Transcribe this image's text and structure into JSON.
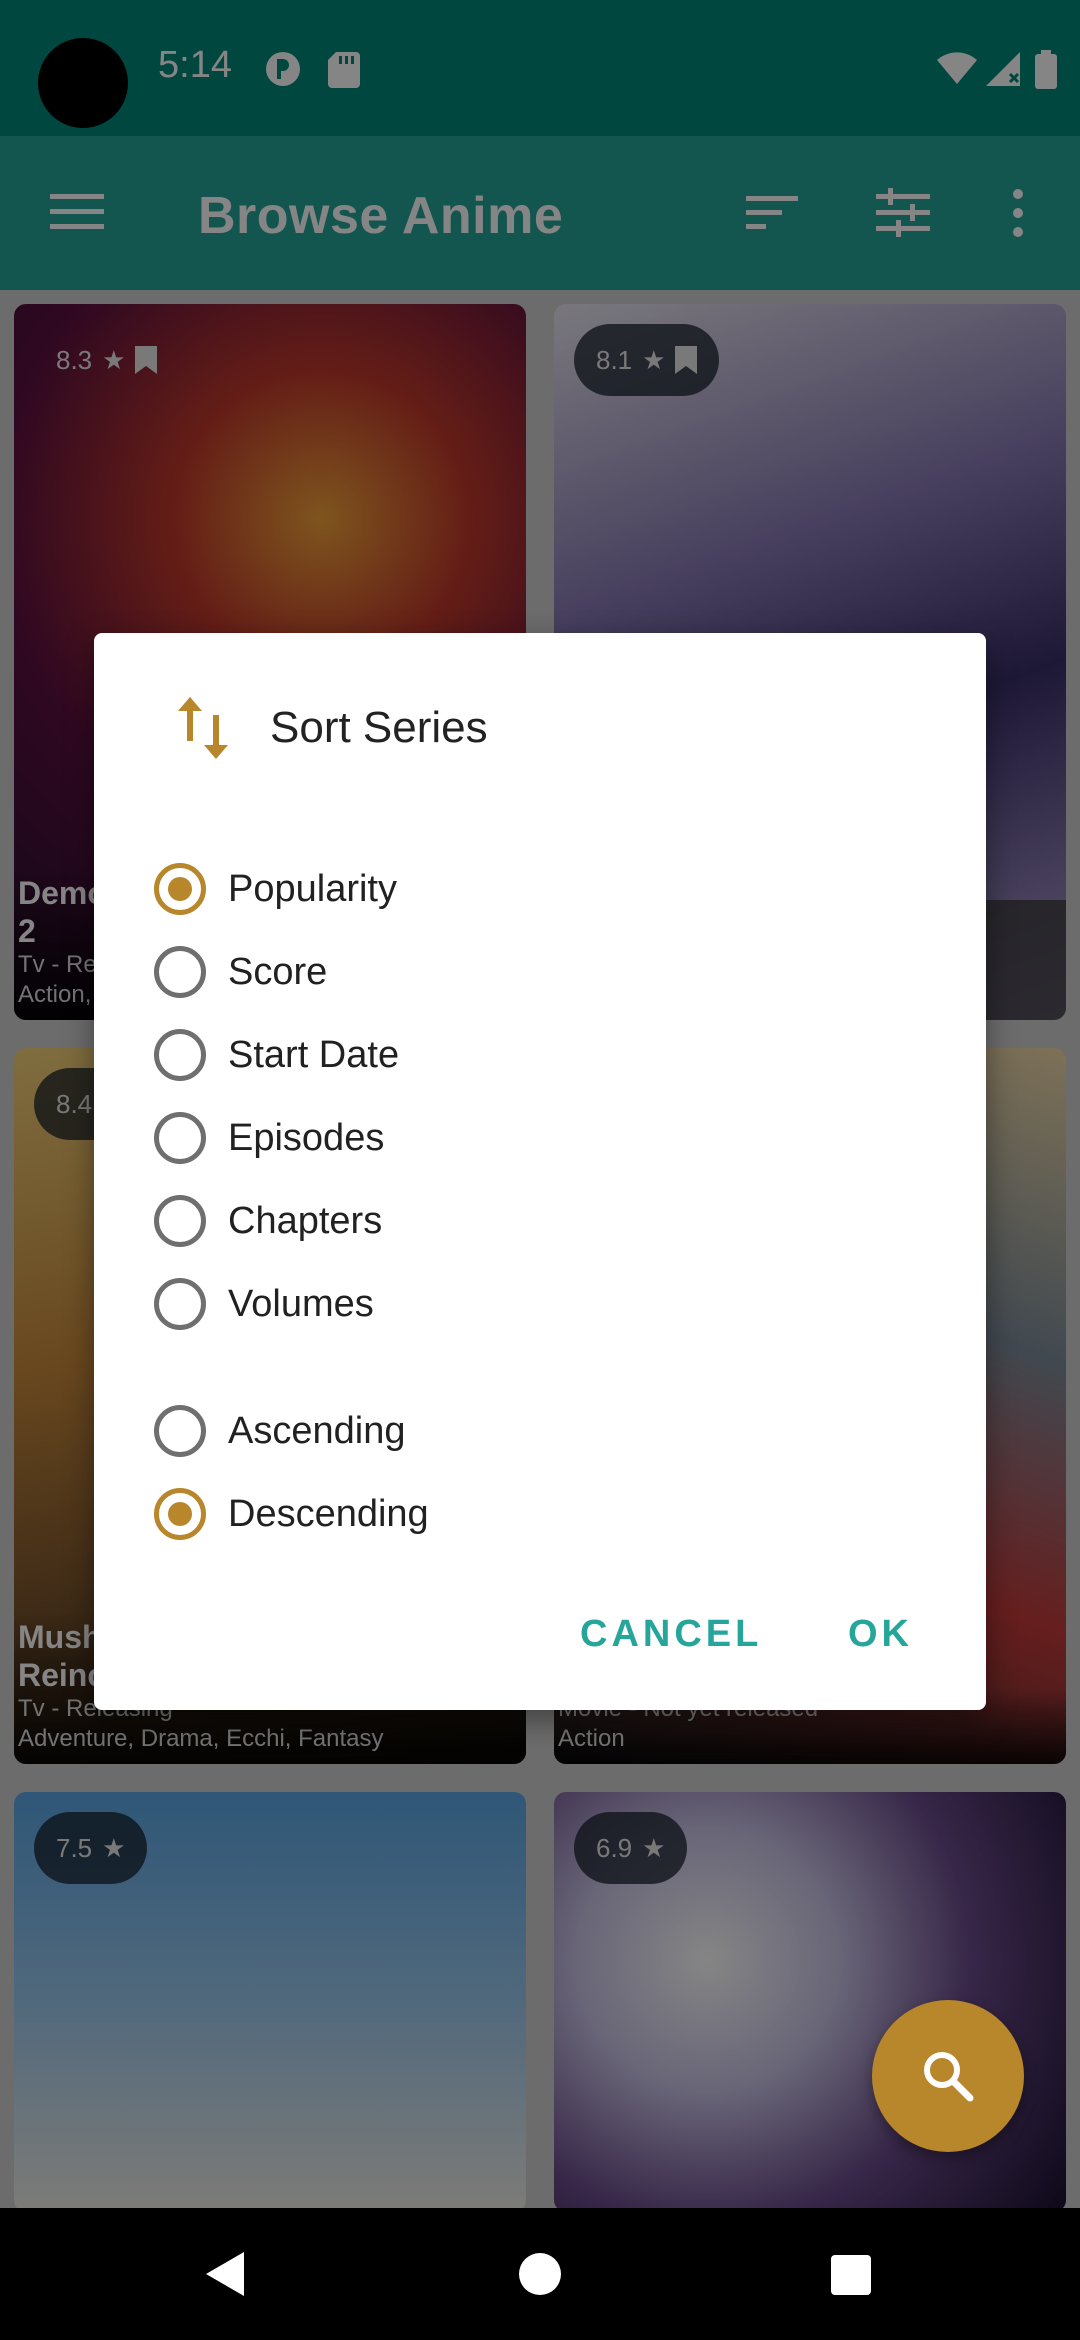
{
  "status_bar": {
    "time": "5:14"
  },
  "app_bar": {
    "title": "Browse Anime",
    "icons": [
      "menu-icon",
      "sort-icon",
      "filter-icon",
      "more-vert-icon"
    ]
  },
  "cards": [
    {
      "score": "8.3",
      "bookmarked": true,
      "title_line1": "Demo",
      "title_line2": "2",
      "meta": "Tv - Rel",
      "genres": "Action,"
    },
    {
      "score": "8.1",
      "bookmarked": true,
      "title_line1": "",
      "title_line2": "",
      "meta": "",
      "genres": ""
    },
    {
      "score": "8.4",
      "bookmarked": false,
      "title_line1": "Mush",
      "title_line2": "Reinc",
      "meta": "Tv - Releasing",
      "genres": "Adventure, Drama, Ecchi, Fantasy"
    },
    {
      "score": "",
      "bookmarked": false,
      "title_line1": "",
      "title_line2": "",
      "meta": "Movie - Not yet released",
      "genres": "Action"
    },
    {
      "score": "7.5",
      "bookmarked": false,
      "title_line1": "",
      "title_line2": "",
      "meta": "",
      "genres": ""
    },
    {
      "score": "6.9",
      "bookmarked": false,
      "title_line1": "",
      "title_line2": "",
      "meta": "",
      "genres": ""
    }
  ],
  "dialog": {
    "title": "Sort Series",
    "sort_options": [
      {
        "label": "Popularity",
        "selected": true
      },
      {
        "label": "Score",
        "selected": false
      },
      {
        "label": "Start Date",
        "selected": false
      },
      {
        "label": "Episodes",
        "selected": false
      },
      {
        "label": "Chapters",
        "selected": false
      },
      {
        "label": "Volumes",
        "selected": false
      }
    ],
    "order_options": [
      {
        "label": "Ascending",
        "selected": false
      },
      {
        "label": "Descending",
        "selected": true
      }
    ],
    "cancel_label": "CANCEL",
    "ok_label": "OK"
  },
  "colors": {
    "accent": "#b8862b",
    "primary": "#26a69a",
    "primary_dark": "#00897b"
  }
}
